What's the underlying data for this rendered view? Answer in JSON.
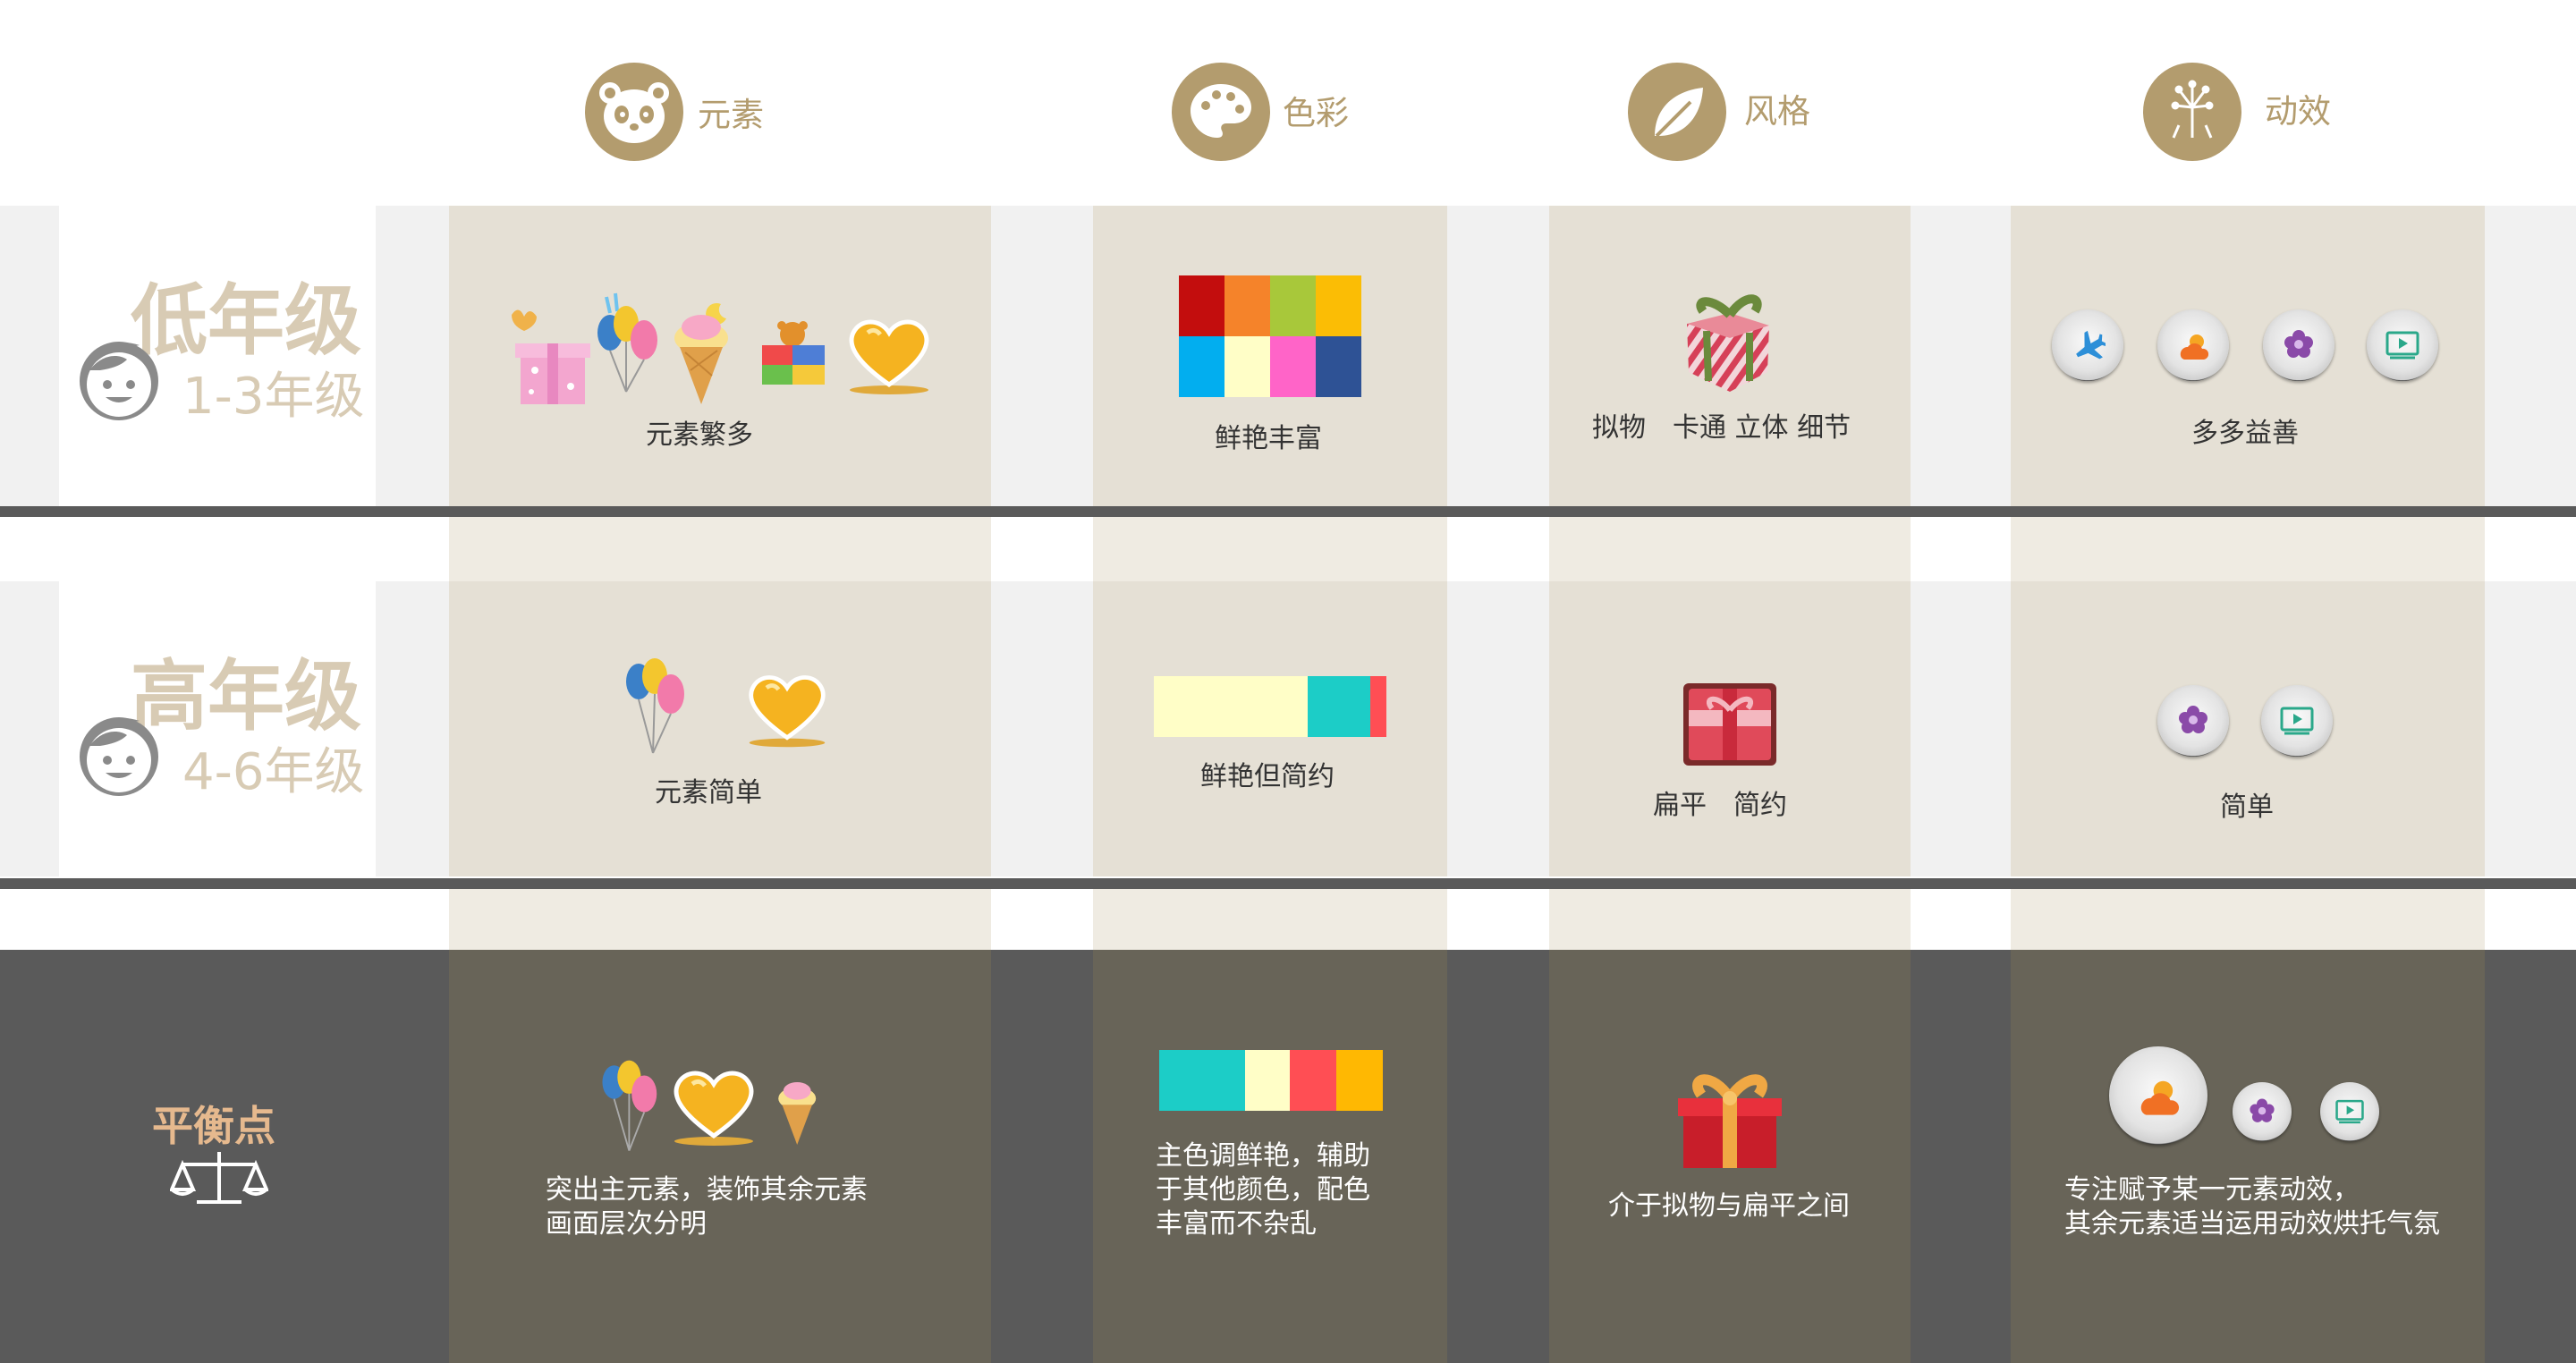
{
  "header": {
    "columns": [
      {
        "label": "元素",
        "icon": "panda-icon"
      },
      {
        "label": "色彩",
        "icon": "palette-icon"
      },
      {
        "label": "风格",
        "icon": "leaf-icon"
      },
      {
        "label": "动效",
        "icon": "fireworks-icon"
      }
    ]
  },
  "rows": [
    {
      "grade": "低年级",
      "range": "1-3年级",
      "element_caption": "元素繁多",
      "color_caption": "鲜艳丰富",
      "style_caption": "拟物　卡通  立体  细节",
      "motion_caption": "多多益善",
      "swatches": [
        "#c30d0d",
        "#f5832a",
        "#a8c83a",
        "#fbbd05",
        "#02aeef",
        "#fffec7",
        "#ff64c8",
        "#2e5295"
      ]
    },
    {
      "grade": "高年级",
      "range": "4-6年级",
      "element_caption": "元素简单",
      "color_caption": "鲜艳但简约",
      "style_caption": "扁平　简约",
      "motion_caption": "简单",
      "swatches": [
        "#fffec7",
        "#1ccdc7",
        "#ff4e54"
      ]
    }
  ],
  "balance": {
    "title": "平衡点",
    "element_caption": "突出主元素，装饰其余元素\n画面层次分明",
    "color_caption": "主色调鲜艳，辅助\n于其他颜色，配色\n丰富而不杂乱",
    "style_caption": "介于拟物与扁平之间",
    "motion_caption": "专注赋予某一元素动效，\n其余元素适当运用动效烘托气氛",
    "swatches": [
      "#1ccdc7",
      "#fffec7",
      "#ff4e54",
      "#ffb802"
    ]
  },
  "colors": {
    "accent": "#b39c6e",
    "dark_band": "#5a5a5a",
    "beige": "#e5e0d5",
    "light_beige": "#efebe2"
  }
}
